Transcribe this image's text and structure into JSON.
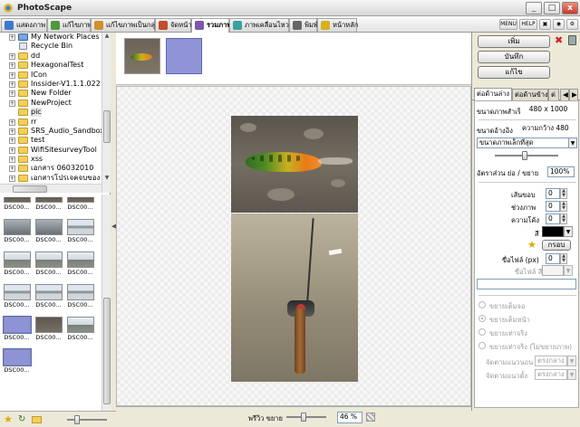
{
  "window": {
    "title": "PhotoScape",
    "btn_min": "_",
    "btn_max": "□",
    "btn_close": "x"
  },
  "tabs": [
    {
      "label": "แสดงภาพ",
      "color": "#3b7ad0"
    },
    {
      "label": "แก้ไขภาพ",
      "color": "#4c9a3a"
    },
    {
      "label": "แก้ไขภาพเป็นกลุ่ม",
      "color": "#d0902b"
    },
    {
      "label": "จัดหน้า",
      "color": "#c44c2b"
    },
    {
      "label": "รวมภาพ",
      "color": "#7d5aa8"
    },
    {
      "label": "ภาพเคลื่อนไหว",
      "color": "#3aa0a0"
    },
    {
      "label": "พิมพ์",
      "color": "#666666"
    },
    {
      "label": "หน้าหลัก",
      "color": "#d8b020"
    }
  ],
  "toolbar_right": {
    "menu": "MENU",
    "help": "HELP"
  },
  "tree": [
    {
      "label": "My Network Places",
      "type": "net",
      "exp": "+"
    },
    {
      "label": "Recycle Bin",
      "type": "bin",
      "exp": ""
    },
    {
      "label": "dd",
      "type": "folder",
      "exp": "+"
    },
    {
      "label": "HexagonalTest",
      "type": "folder",
      "exp": "+"
    },
    {
      "label": "ICon",
      "type": "folder",
      "exp": "+"
    },
    {
      "label": "Inssider-V1.1.1.022",
      "type": "folder",
      "exp": "+"
    },
    {
      "label": "New Folder",
      "type": "folder",
      "exp": "+"
    },
    {
      "label": "NewProject",
      "type": "folder",
      "exp": "+"
    },
    {
      "label": "pic",
      "type": "folder",
      "exp": ""
    },
    {
      "label": "rr",
      "type": "folder",
      "exp": "+"
    },
    {
      "label": "SRS_Audio_Sandbox",
      "type": "folder",
      "exp": "+"
    },
    {
      "label": "test",
      "type": "folder",
      "exp": "+"
    },
    {
      "label": "WifiSitesurveyTool",
      "type": "folder",
      "exp": "+"
    },
    {
      "label": "xss",
      "type": "folder",
      "exp": "+"
    },
    {
      "label": "เอกสาร 06032010",
      "type": "folder",
      "exp": "+"
    },
    {
      "label": "เอกสารโปรเจคจบของ",
      "type": "folder",
      "exp": "+"
    }
  ],
  "thumbnails": [
    {
      "label": "DSC00...",
      "style": "dark"
    },
    {
      "label": "DSC00...",
      "style": "dark"
    },
    {
      "label": "DSC00...",
      "style": "dark"
    },
    {
      "label": "DSC00...",
      "style": "person"
    },
    {
      "label": "DSC00...",
      "style": "person"
    },
    {
      "label": "DSC00...",
      "style": "water"
    },
    {
      "label": "DSC00...",
      "style": "water2"
    },
    {
      "label": "DSC00...",
      "style": "water2"
    },
    {
      "label": "DSC00...",
      "style": "water2"
    },
    {
      "label": "DSC00...",
      "style": "water"
    },
    {
      "label": "DSC00...",
      "style": "water"
    },
    {
      "label": "DSC00...",
      "style": "water"
    },
    {
      "label": "DSC00...",
      "style": "purple"
    },
    {
      "label": "DSC00...",
      "style": "fish"
    },
    {
      "label": "DSC00...",
      "style": "water2"
    },
    {
      "label": "DSC00...",
      "style": "purple"
    }
  ],
  "right": {
    "add_btn": "เพิ่ม",
    "save_btn": "บันทึก",
    "edit_btn": "แก้ไข",
    "tabs": [
      "ต่อด้านล่าง",
      "ต่อด้านข้าง",
      "ต่"
    ],
    "size_label": "ขนาดภาพสำเร็จ",
    "size_value": "480 x 1000",
    "ref_label": "ขนาดอ้างอิง",
    "ref_value": "ความกว้าง 480",
    "ref_select": "ขนาดภาพเล็กที่สุด",
    "ratio_label": "อัตราส่วน ย่อ / ขยาย",
    "ratio_value": "100%",
    "border_label": "เส้นขอบ",
    "border_value": "0",
    "gap_label": "ช่วงภาพ",
    "gap_value": "0",
    "round_label": "ความโค้ง",
    "round_value": "0",
    "color_label": "สี",
    "frame_label": "กรอบ",
    "filesize_label": "ขื่อไฟล์ (px)",
    "filesize_value": "0",
    "filecolor_label": "ขื่อไฟล์ สี",
    "radio1": "ขยายเต็มจอ",
    "radio2": "ขยายเต็มหน้า",
    "radio3": "ขยายเท่าจริง",
    "radio4": "ขยายเท่าจริง (ไม่ขยายภาพ)",
    "halign_label": "จัดตามแนวนอน",
    "halign_value": "ตรงกลาง",
    "valign_label": "จัดตามแนวตั้ง",
    "valign_value": "ตรงกลาง"
  },
  "status": {
    "preview_label": "พรีวิว ขยาย",
    "zoom": "46 %"
  }
}
